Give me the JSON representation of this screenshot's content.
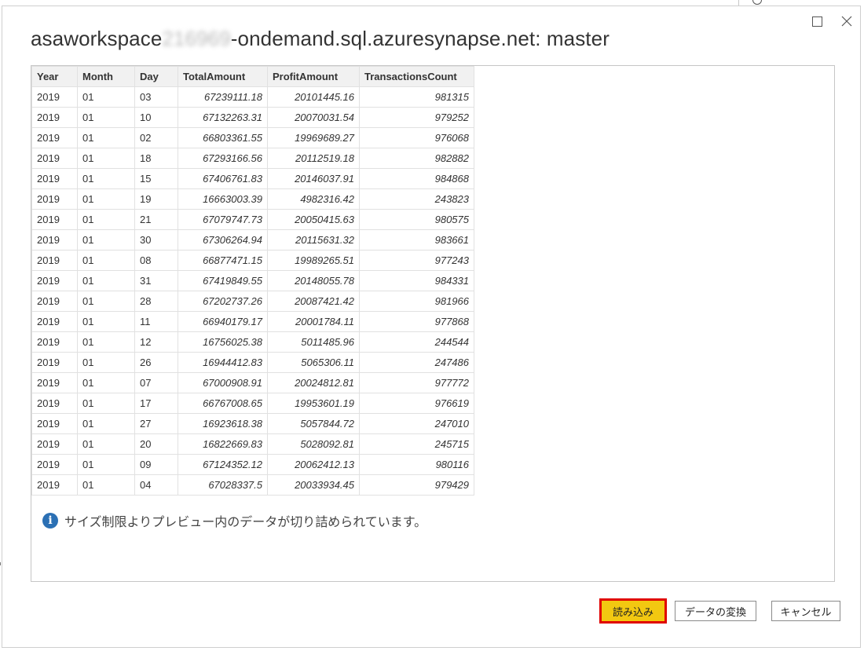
{
  "dialog": {
    "title_prefix": "asaworkspace",
    "title_blurred": "216969",
    "title_suffix": "-ondemand.sql.azuresynapse.net: master"
  },
  "table": {
    "columns": [
      "Year",
      "Month",
      "Day",
      "TotalAmount",
      "ProfitAmount",
      "TransactionsCount"
    ],
    "rows": [
      [
        "2019",
        "01",
        "03",
        "67239111.18",
        "20101445.16",
        "981315"
      ],
      [
        "2019",
        "01",
        "10",
        "67132263.31",
        "20070031.54",
        "979252"
      ],
      [
        "2019",
        "01",
        "02",
        "66803361.55",
        "19969689.27",
        "976068"
      ],
      [
        "2019",
        "01",
        "18",
        "67293166.56",
        "20112519.18",
        "982882"
      ],
      [
        "2019",
        "01",
        "15",
        "67406761.83",
        "20146037.91",
        "984868"
      ],
      [
        "2019",
        "01",
        "19",
        "16663003.39",
        "4982316.42",
        "243823"
      ],
      [
        "2019",
        "01",
        "21",
        "67079747.73",
        "20050415.63",
        "980575"
      ],
      [
        "2019",
        "01",
        "30",
        "67306264.94",
        "20115631.32",
        "983661"
      ],
      [
        "2019",
        "01",
        "08",
        "66877471.15",
        "19989265.51",
        "977243"
      ],
      [
        "2019",
        "01",
        "31",
        "67419849.55",
        "20148055.78",
        "984331"
      ],
      [
        "2019",
        "01",
        "28",
        "67202737.26",
        "20087421.42",
        "981966"
      ],
      [
        "2019",
        "01",
        "11",
        "66940179.17",
        "20001784.11",
        "977868"
      ],
      [
        "2019",
        "01",
        "12",
        "16756025.38",
        "5011485.96",
        "244544"
      ],
      [
        "2019",
        "01",
        "26",
        "16944412.83",
        "5065306.11",
        "247486"
      ],
      [
        "2019",
        "01",
        "07",
        "67000908.91",
        "20024812.81",
        "977772"
      ],
      [
        "2019",
        "01",
        "17",
        "66767008.65",
        "19953601.19",
        "976619"
      ],
      [
        "2019",
        "01",
        "27",
        "16923618.38",
        "5057844.72",
        "247010"
      ],
      [
        "2019",
        "01",
        "20",
        "16822669.83",
        "5028092.81",
        "245715"
      ],
      [
        "2019",
        "01",
        "09",
        "67124352.12",
        "20062412.13",
        "980116"
      ],
      [
        "2019",
        "01",
        "04",
        "67028337.5",
        "20033934.45",
        "979429"
      ]
    ]
  },
  "info_message": "サイズ制限よりプレビュー内のデータが切り詰められています。",
  "buttons": {
    "load": "読み込み",
    "transform": "データの変換",
    "cancel": "キャンセル"
  },
  "colors": {
    "load_button_bg": "#f2c811",
    "highlight_outline": "#e00000",
    "info_icon": "#2b70b4"
  }
}
